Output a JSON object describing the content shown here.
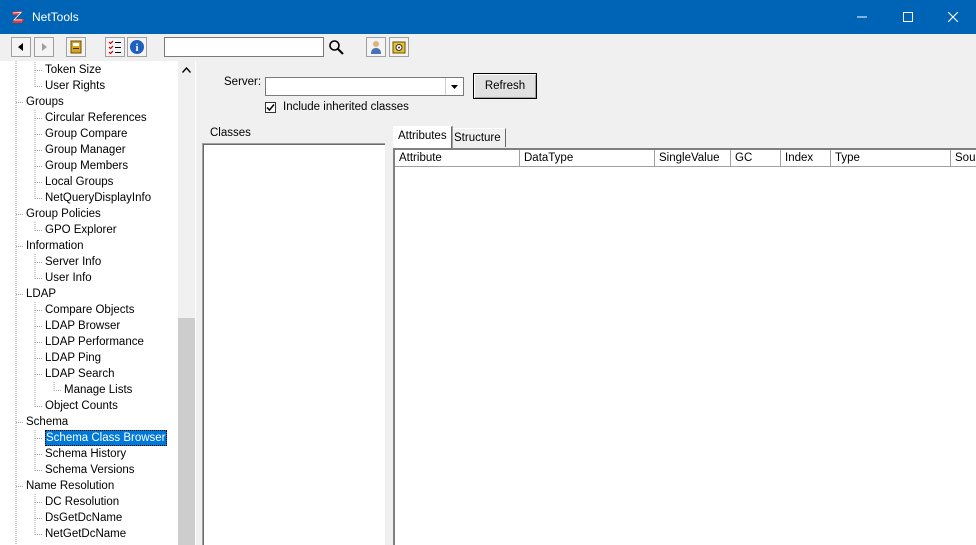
{
  "window": {
    "title": "NetTools",
    "controls": [
      "minimize",
      "maximize",
      "close"
    ]
  },
  "toolbar": {
    "buttons": [
      "back-icon",
      "forward-icon",
      "book-icon",
      "checklist-icon",
      "info-icon"
    ],
    "search": {
      "value": "",
      "placeholder": ""
    },
    "extra_buttons": [
      "user-icon",
      "settings-icon"
    ]
  },
  "tree": {
    "items": [
      {
        "label": "Token Size",
        "level": 1
      },
      {
        "label": "User Rights",
        "level": 1
      },
      {
        "label": "Groups",
        "level": 0
      },
      {
        "label": "Circular References",
        "level": 1
      },
      {
        "label": "Group Compare",
        "level": 1
      },
      {
        "label": "Group Manager",
        "level": 1
      },
      {
        "label": "Group Members",
        "level": 1
      },
      {
        "label": "Local Groups",
        "level": 1
      },
      {
        "label": "NetQueryDisplayInfo",
        "level": 1
      },
      {
        "label": "Group Policies",
        "level": 0
      },
      {
        "label": "GPO Explorer",
        "level": 1
      },
      {
        "label": "Information",
        "level": 0
      },
      {
        "label": "Server Info",
        "level": 1
      },
      {
        "label": "User Info",
        "level": 1
      },
      {
        "label": "LDAP",
        "level": 0
      },
      {
        "label": "Compare Objects",
        "level": 1
      },
      {
        "label": "LDAP Browser",
        "level": 1
      },
      {
        "label": "LDAP Performance",
        "level": 1
      },
      {
        "label": "LDAP Ping",
        "level": 1
      },
      {
        "label": "LDAP Search",
        "level": 1
      },
      {
        "label": "Manage Lists",
        "level": 2
      },
      {
        "label": "Object Counts",
        "level": 1
      },
      {
        "label": "Schema",
        "level": 0
      },
      {
        "label": "Schema Class Browser",
        "level": 1,
        "selected": true
      },
      {
        "label": "Schema History",
        "level": 1
      },
      {
        "label": "Schema Versions",
        "level": 1
      },
      {
        "label": "Name Resolution",
        "level": 0
      },
      {
        "label": "DC Resolution",
        "level": 1
      },
      {
        "label": "DsGetDcName",
        "level": 1
      },
      {
        "label": "NetGetDcName",
        "level": 1
      }
    ]
  },
  "server": {
    "label": "Server:",
    "value": "",
    "refresh_label": "Refresh",
    "include_inherited_label": "Include inherited classes",
    "include_inherited_checked": true
  },
  "classes": {
    "label": "Classes",
    "items": []
  },
  "tabs": [
    {
      "label": "Attributes",
      "active": true
    },
    {
      "label": "Structure",
      "active": false
    }
  ],
  "grid": {
    "columns": [
      "Attribute",
      "DataType",
      "SingleValue",
      "GC",
      "Index",
      "Type",
      "Sou"
    ],
    "rows": []
  },
  "colors": {
    "titlebar": "#0064b6",
    "selection": "#0078d7"
  }
}
